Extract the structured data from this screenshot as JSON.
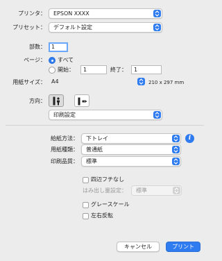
{
  "printer": {
    "label": "プリンタ：",
    "value": "EPSON XXXX"
  },
  "presets": {
    "label": "プリセット：",
    "value": "デフォルト設定"
  },
  "copies": {
    "label": "部数：",
    "value": "1"
  },
  "pages": {
    "label": "ページ：",
    "all_label": "すべて",
    "from_label": "開始：",
    "from_value": "1",
    "to_label": "終了：",
    "to_value": "1"
  },
  "paper_size": {
    "label": "用紙サイズ：",
    "value": "A4",
    "dimensions": "210 x 297 mm"
  },
  "orientation": {
    "label": "方向："
  },
  "section_menu": {
    "value": "印刷設定"
  },
  "print_settings": {
    "paper_source": {
      "label": "給紙方法：",
      "value": "下トレイ"
    },
    "media_type": {
      "label": "用紙種類：",
      "value": "普通紙"
    },
    "print_quality": {
      "label": "印刷品質：",
      "value": "標準"
    }
  },
  "options": {
    "borderless": "四辺フチなし",
    "expansion": {
      "label": "はみ出し量設定：",
      "value": "標準"
    },
    "grayscale": "グレースケール",
    "mirror": "左右反転"
  },
  "buttons": {
    "cancel": "キャンセル",
    "print": "プリント"
  },
  "colors": {
    "accent": "#2f7bf0",
    "background": "#ececec"
  },
  "icons": [
    "chevron-updown-icon",
    "portrait-orientation-icon",
    "landscape-orientation-icon",
    "info-icon"
  ]
}
